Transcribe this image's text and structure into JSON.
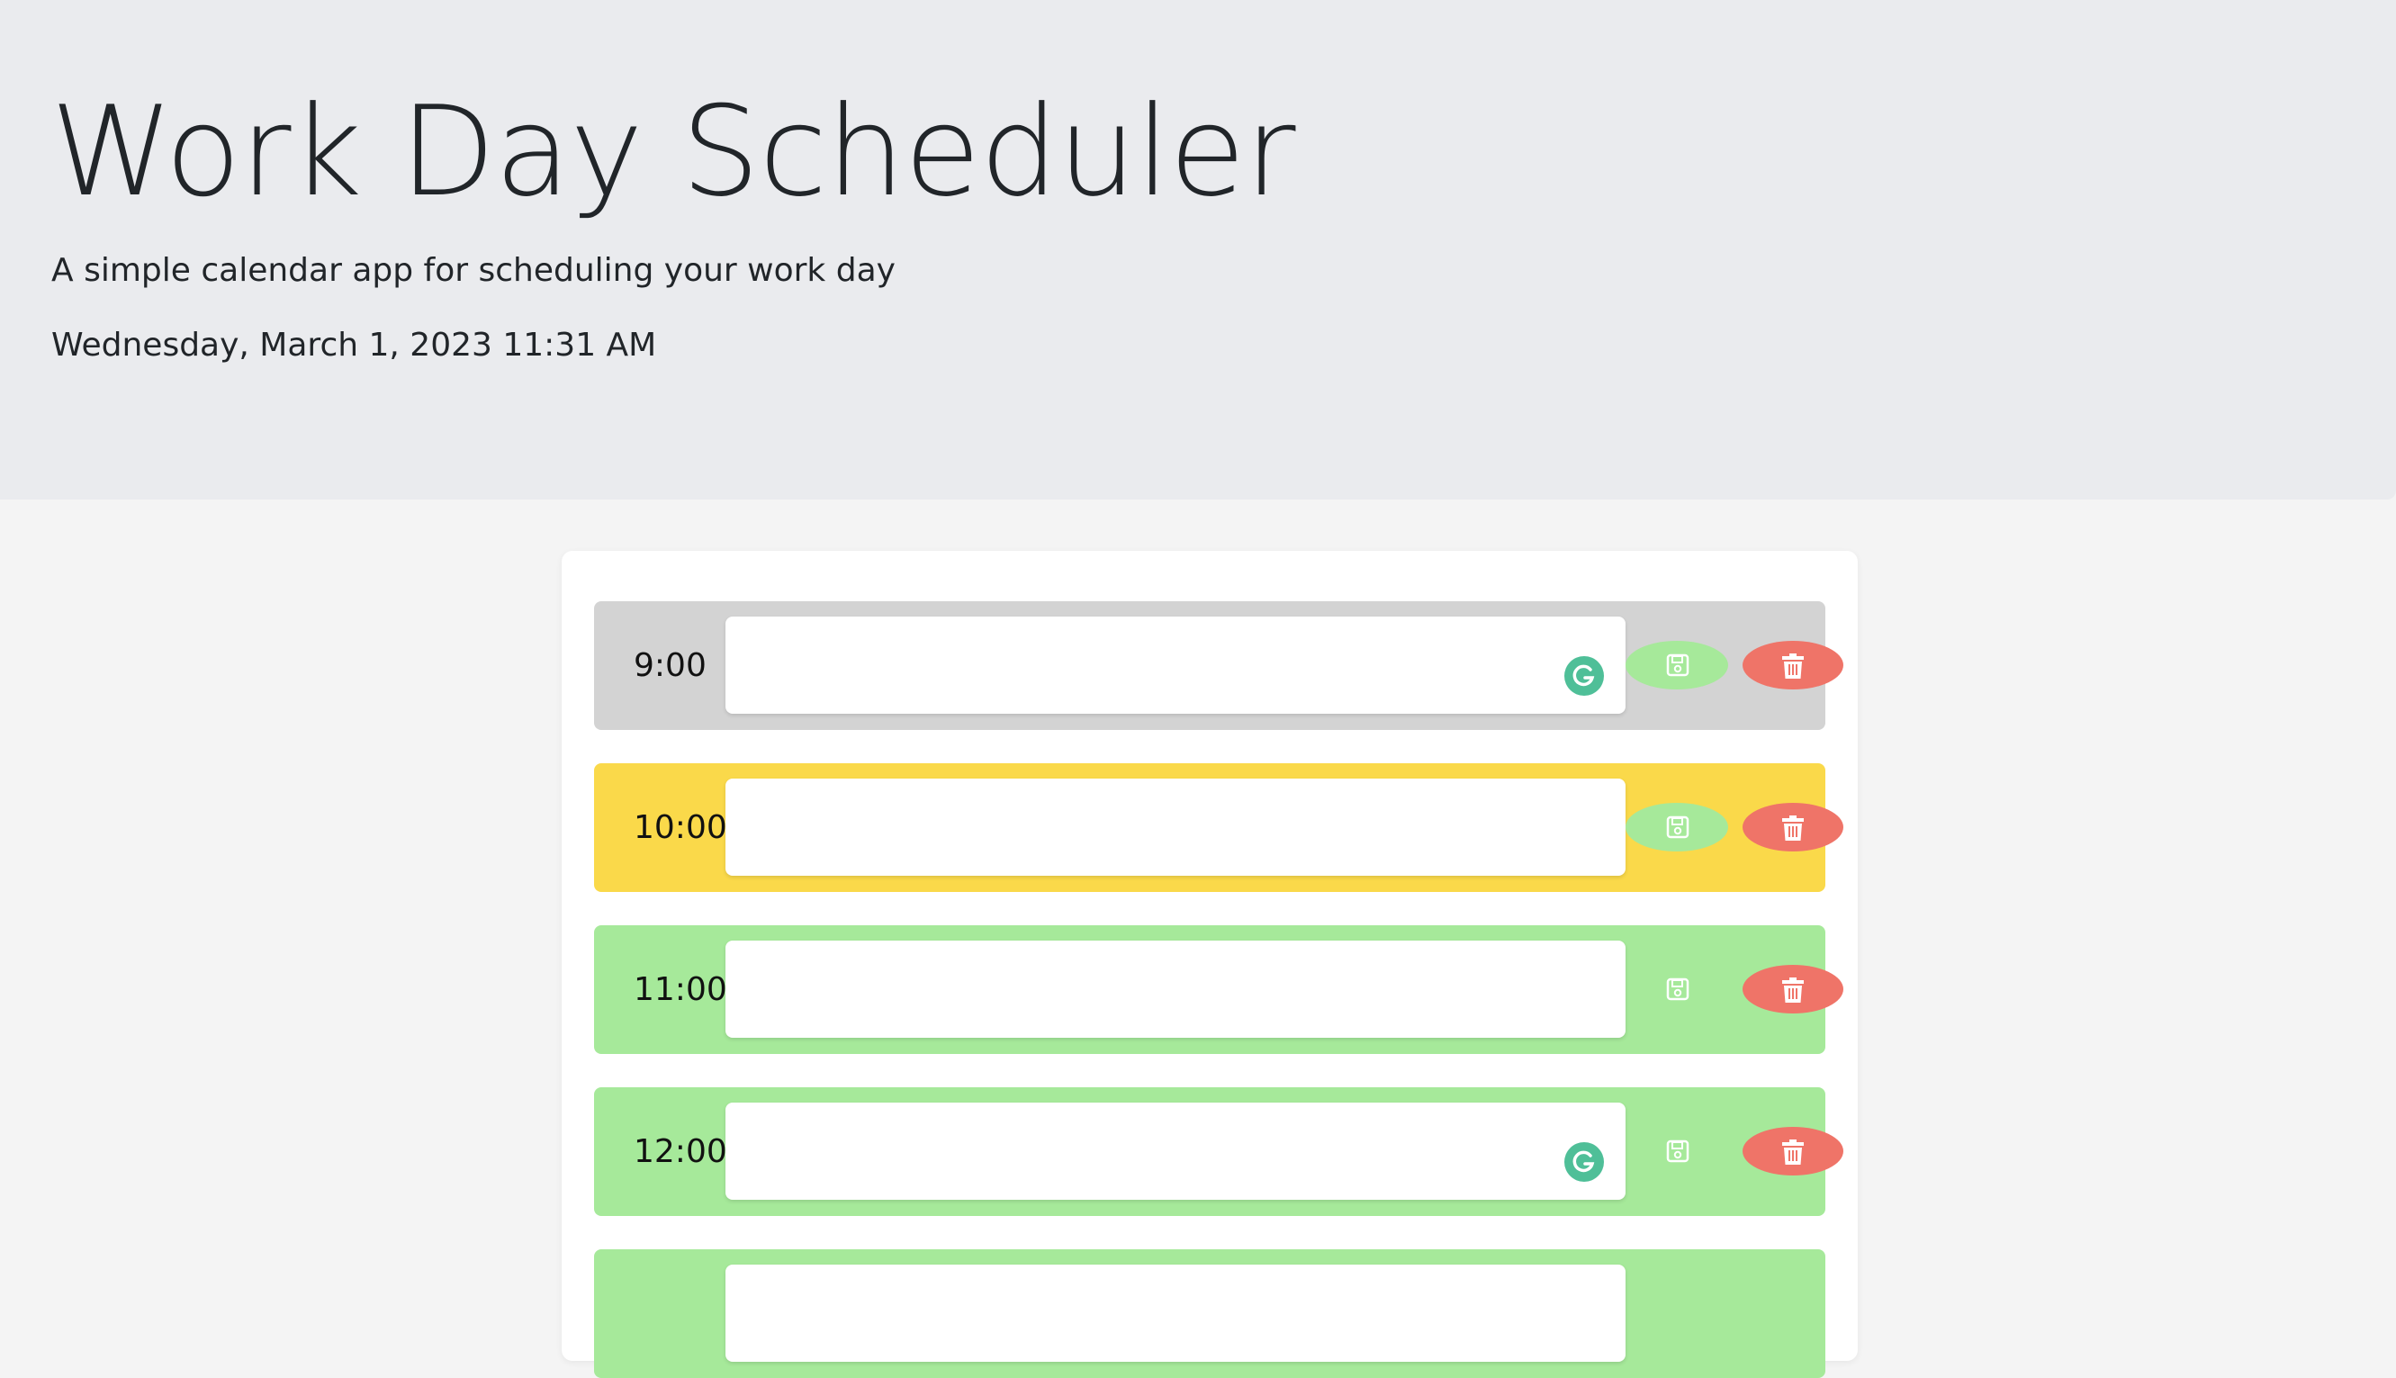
{
  "header": {
    "title": "Work Day Scheduler",
    "subtitle": "A simple calendar app for scheduling your work day",
    "current_datetime": "Wednesday, March 1, 2023 11:31 AM"
  },
  "colors": {
    "past": "#d3d3d3",
    "present": "#fad94a",
    "future": "#a6e99a",
    "save": "#a6e99a",
    "delete": "#ef7468",
    "header_bg": "#eaebee"
  },
  "timeblocks": [
    {
      "hour": "9:00",
      "state": "past",
      "description": "",
      "save_icon": "floppy-disk-icon",
      "delete_icon": "trash-icon"
    },
    {
      "hour": "10:00",
      "state": "present",
      "description": "",
      "save_icon": "floppy-disk-icon",
      "delete_icon": "trash-icon"
    },
    {
      "hour": "11:00",
      "state": "future",
      "description": "",
      "save_icon": "floppy-disk-icon",
      "delete_icon": "trash-icon"
    },
    {
      "hour": "12:00",
      "state": "future",
      "description": "",
      "save_icon": "floppy-disk-icon",
      "delete_icon": "trash-icon"
    },
    {
      "hour": "",
      "state": "future",
      "description": "",
      "save_icon": "floppy-disk-icon",
      "delete_icon": "trash-icon"
    }
  ]
}
